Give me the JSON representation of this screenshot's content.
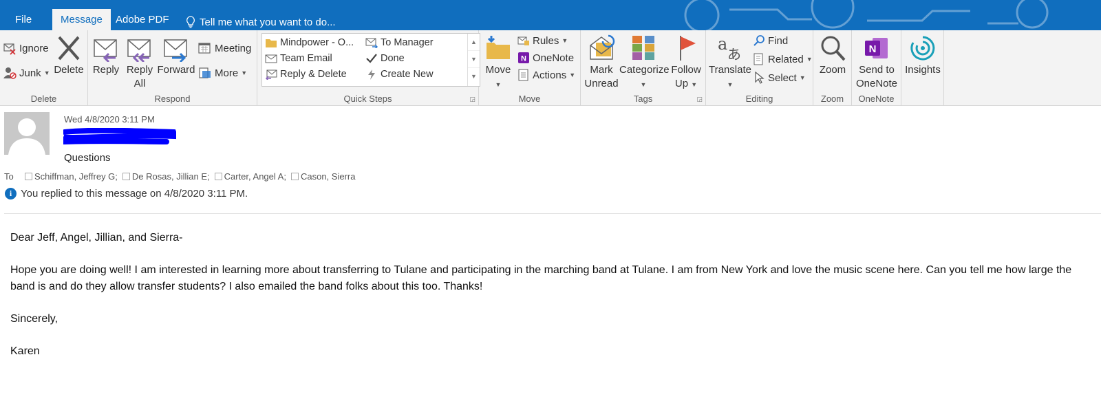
{
  "tabs": [
    {
      "label": "File"
    },
    {
      "label": "Message"
    },
    {
      "label": "Adobe PDF"
    },
    {
      "label": "Tell me what you want to do..."
    }
  ],
  "ribbon": {
    "delete_group": {
      "label": "Delete",
      "ignore": "Ignore",
      "junk": "Junk",
      "delete": "Delete"
    },
    "respond_group": {
      "label": "Respond",
      "reply": "Reply",
      "reply_all_1": "Reply",
      "reply_all_2": "All",
      "forward": "Forward",
      "meeting": "Meeting",
      "more": "More"
    },
    "quicksteps_group": {
      "label": "Quick Steps",
      "items": [
        "Mindpower - O...",
        "To Manager",
        "Team Email",
        "Done",
        "Reply & Delete",
        "Create New"
      ]
    },
    "move_group": {
      "label": "Move",
      "move": "Move",
      "rules": "Rules",
      "onenote": "OneNote",
      "actions": "Actions"
    },
    "tags_group": {
      "label": "Tags",
      "mark_1": "Mark",
      "mark_2": "Unread",
      "categorize": "Categorize",
      "follow_1": "Follow",
      "follow_2": "Up"
    },
    "editing_group": {
      "label": "Editing",
      "translate": "Translate",
      "find": "Find",
      "related": "Related",
      "select": "Select"
    },
    "zoom_group": {
      "label": "Zoom",
      "zoom": "Zoom"
    },
    "onenote_group": {
      "label": "OneNote",
      "send_1": "Send to",
      "send_2": "OneNote"
    },
    "insights": "Insights"
  },
  "message": {
    "date": "Wed 4/8/2020 3:11 PM",
    "subject": "Questions",
    "to_label": "To",
    "recipients": [
      "Schiffman, Jeffrey G;",
      "De Rosas, Jillian E;",
      "Carter, Angel A;",
      "Cason, Sierra"
    ],
    "info": "You replied to this message on 4/8/2020 3:11 PM.",
    "body": [
      "Dear Jeff, Angel, Jillian, and Sierra-",
      "Hope you are doing well! I am interested in learning more about transferring to Tulane and participating in the marching band at Tulane. I am from New York and love the music scene here. Can you tell me how large the band is and do they allow transfer students? I also emailed the band folks about this too. Thanks!",
      "Sincerely,",
      "Karen"
    ]
  },
  "colors": {
    "accent": "#106ebe",
    "ribbon_bg": "#f3f3f3",
    "redaction": "#0000ff",
    "follow_flag": "#e0523a",
    "onenote": "#7719aa",
    "insights": "#1aa0b8"
  }
}
